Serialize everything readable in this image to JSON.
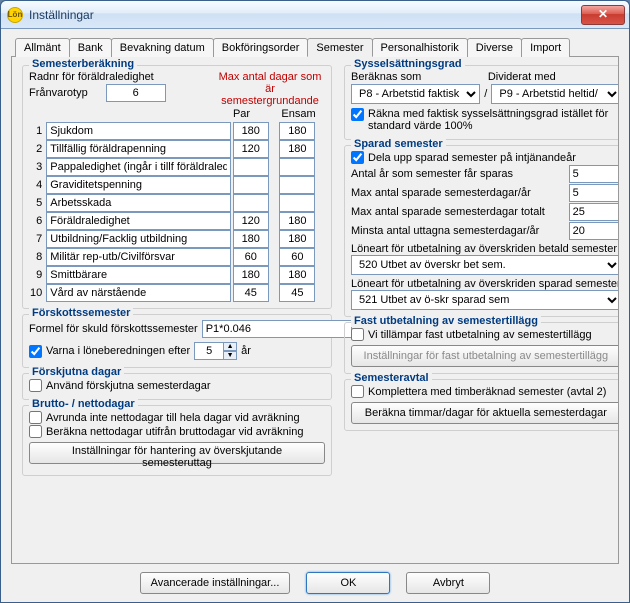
{
  "window": {
    "title": "Inställningar",
    "icon_text": "Lön",
    "close_glyph": "✕"
  },
  "tabs": {
    "allmant": "Allmänt",
    "bank": "Bank",
    "bevak": "Bevakning datum",
    "bokf": "Bokföringsorder",
    "semester": "Semester",
    "pers": "Personalhistorik",
    "diverse": "Diverse",
    "import": "Import"
  },
  "sem": {
    "title": "Semesterberäkning",
    "l_radnr": "Radnr för föräldraledighet",
    "l_franvaro": "Frånvarotyp",
    "radnr": "6",
    "redline1": "Max antal dagar som är",
    "redline2": "semestergrundande",
    "h_par": "Par",
    "h_ensam": "Ensam",
    "rows": [
      {
        "n": "1",
        "name": "Sjukdom",
        "par": "180",
        "ensam": "180"
      },
      {
        "n": "2",
        "name": "Tillfällig föräldrapenning",
        "par": "120",
        "ensam": "180"
      },
      {
        "n": "3",
        "name": "Pappaledighet (ingår i tillf föräldraledig)",
        "par": "",
        "ensam": ""
      },
      {
        "n": "4",
        "name": "Graviditetspenning",
        "par": "",
        "ensam": ""
      },
      {
        "n": "5",
        "name": "Arbetsskada",
        "par": "",
        "ensam": ""
      },
      {
        "n": "6",
        "name": "Föräldraledighet",
        "par": "120",
        "ensam": "180"
      },
      {
        "n": "7",
        "name": "Utbildning/Facklig utbildning",
        "par": "180",
        "ensam": "180"
      },
      {
        "n": "8",
        "name": "Militär rep-utb/Civilförsvar",
        "par": "60",
        "ensam": "60"
      },
      {
        "n": "9",
        "name": "Smittbärare",
        "par": "180",
        "ensam": "180"
      },
      {
        "n": "10",
        "name": "Vård av närstående",
        "par": "45",
        "ensam": "45"
      }
    ]
  },
  "forskott": {
    "title": "Förskottssemester",
    "l_formel": "Formel för skuld förskottssemester",
    "formel": "P1*0.046",
    "chk_warn": "Varna i löneberedningen efter",
    "warn_val": "5",
    "unit": "år"
  },
  "forskjut": {
    "title": "Förskjutna dagar",
    "chk": "Använd förskjutna semesterdagar"
  },
  "brutto": {
    "title": "Brutto- / nettodagar",
    "c1": "Avrunda inte nettodagar till hela dagar vid avräkning",
    "c2": "Beräkna nettodagar utifrån bruttodagar vid avräkning",
    "btn": "Inställningar för hantering av överskjutande semesteruttag"
  },
  "syssel": {
    "title": "Sysselsättningsgrad",
    "l_ber": "Beräknas som",
    "l_div": "Dividerat med",
    "combo1": "P8 - Arbetstid faktisk",
    "combo2": "P9 - Arbetstid heltid/",
    "sep": "/",
    "chk": "Räkna med faktisk sysselsättningsgrad istället för standard värde 100%"
  },
  "sparad": {
    "title": "Sparad semester",
    "chk": "Dela upp sparad semester på intjänandeår",
    "l1": "Antal år som semester får sparas",
    "v1": "5",
    "l2": "Max antal sparade semesterdagar/år",
    "v2": "5",
    "l3": "Max antal sparade semesterdagar totalt",
    "v3": "25",
    "l4": "Minsta antal uttagna semesterdagar/år",
    "v4": "20",
    "l_lon1": "Löneart för utbetalning av överskriden betald semester",
    "combo_lon1": "520 Utbet av överskr bet sem.",
    "l_lon2": "Löneart för utbetalning av överskriden sparad semester",
    "combo_lon2": "521 Utbet av ö-skr sparad sem"
  },
  "fast": {
    "title": "Fast utbetalning av semestertillägg",
    "chk": "Vi tillämpar fast utbetalning av semestertillägg",
    "btn": "Inställningar för fast utbetalning av semestertillägg"
  },
  "avtal": {
    "title": "Semesteravtal",
    "chk": "Komplettera med timberäknad semester (avtal 2)",
    "btn": "Beräkna timmar/dagar för aktuella semesterdagar"
  },
  "footer": {
    "adv": "Avancerade inställningar...",
    "ok": "OK",
    "cancel": "Avbryt"
  }
}
